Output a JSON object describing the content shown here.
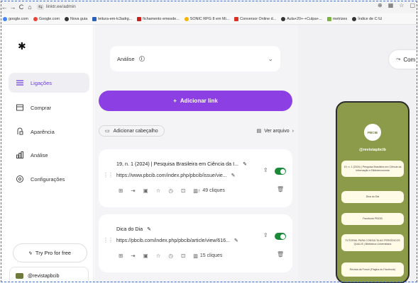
{
  "browser": {
    "url": "linktr.ee/admin",
    "bookmarks": [
      "google.com",
      "Google.com",
      "Nova guia",
      "leitura-em-lc3adrg...",
      "fichamento emesde...",
      "SONIC RPG 8 em Mi...",
      "Conversor Online d...",
      "Aula+20+-+Culpa+...",
      "metrizes",
      "Índice de C:\\U"
    ]
  },
  "sidebar": {
    "items": [
      {
        "label": "Ligações",
        "icon": "links-icon"
      },
      {
        "label": "Comprar",
        "icon": "shop-icon"
      },
      {
        "label": "Aparência",
        "icon": "appearance-icon"
      },
      {
        "label": "Análise",
        "icon": "analytics-icon"
      },
      {
        "label": "Configurações",
        "icon": "settings-icon"
      }
    ],
    "try_pro": "Try Pro for free",
    "account": "@revistapbcib"
  },
  "main": {
    "analise_label": "Análise",
    "add_link": "Adicionar link",
    "add_header": "Adicionar cabeçalho",
    "view_archive": "Ver arquivo",
    "cards": [
      {
        "title": "19, n. 1 (2024) | Pesquisa Brasileira em Ciência da I...",
        "url": "https://www.pbcib.com/index.php/pbcib/issue/vie...",
        "clicks": "49 cliques",
        "enabled": true
      },
      {
        "title": "Dica do Dia",
        "url": "https://pbcib.com/index.php/pbcib/article/view/616...",
        "clicks": "15 cliques",
        "enabled": true
      }
    ]
  },
  "preview": {
    "share_label": "Com",
    "badge": "PBCIB",
    "profile_name": "@revistapbcib",
    "links": [
      "19, n. 1 (2024) | Pesquisa Brasileira em Ciência da Informação e Biblioteconomia",
      "Dica do Dia",
      "Facebook PBCIB",
      "TUTORIAL PARA CONSULTA AO PERIÓDICOS QUALIS | Biblioteca Universitária",
      "Revista da Forum (Página do Facebook)"
    ]
  },
  "colors": {
    "accent": "#8c3fe3",
    "toggle_on": "#1a8a3a",
    "theme": "#8c9b4a"
  }
}
